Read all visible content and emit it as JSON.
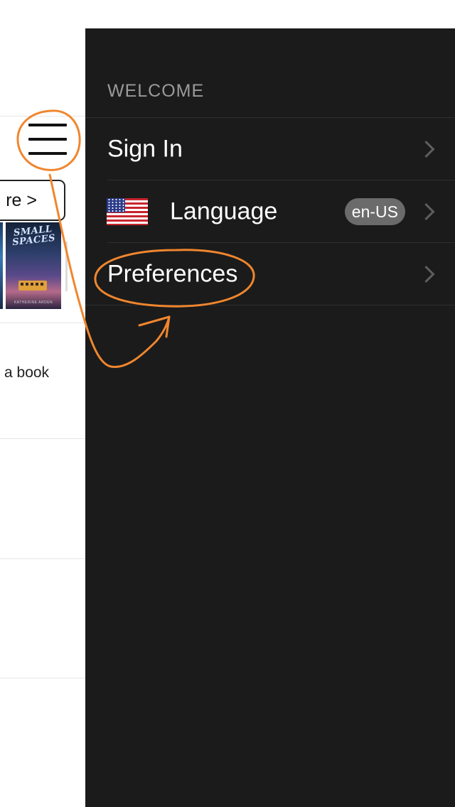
{
  "background_app": {
    "more_button_label": "re >",
    "book": {
      "title_line1": "SMALL",
      "title_line2": "SPACES",
      "author": "KATHERINE ARDEN"
    },
    "partial_text": "a book"
  },
  "drawer": {
    "section_header": "WELCOME",
    "items": [
      {
        "label": "Sign In"
      },
      {
        "label": "Language",
        "badge": "en-US",
        "flag": "us-flag-icon"
      },
      {
        "label": "Preferences"
      }
    ]
  },
  "colors": {
    "drawer_background": "#1b1b1b",
    "annotation": "#f0862e",
    "badge_background": "#6b6b6b",
    "header_text": "#9a9a9a"
  }
}
